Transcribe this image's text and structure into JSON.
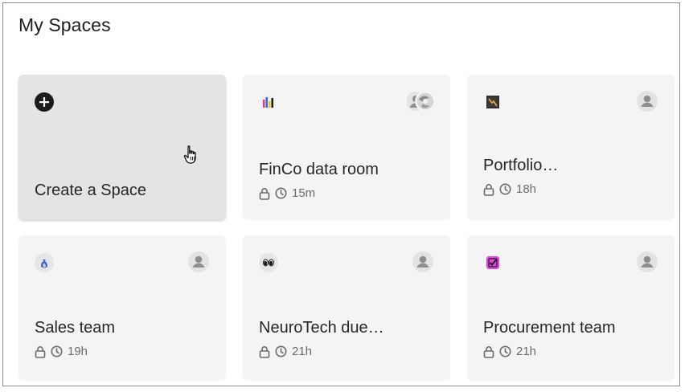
{
  "page": {
    "title": "My Spaces"
  },
  "create_card": {
    "label": "Create a Space",
    "icon": "plus-circle-icon"
  },
  "spaces": [
    {
      "name": "FinCo data room",
      "time": "15m",
      "icon": "bar-chart-emoji-icon",
      "avatar": "shared-avatars-icon"
    },
    {
      "name": "Portfolio…",
      "time": "18h",
      "icon": "chart-down-emoji-icon",
      "avatar": "user-avatar-icon"
    },
    {
      "name": "Sales team",
      "time": "19h",
      "icon": "money-bag-emoji-icon",
      "avatar": "user-avatar-icon"
    },
    {
      "name": "NeuroTech due…",
      "time": "21h",
      "icon": "eyes-emoji-icon",
      "avatar": "user-avatar-icon"
    },
    {
      "name": "Procurement team",
      "time": "21h",
      "icon": "checkbox-emoji-icon",
      "avatar": "user-avatar-icon"
    }
  ],
  "colors": {
    "card_bg": "#f4f4f4",
    "create_card_bg": "#e4e4e4",
    "text": "#1f1f1f",
    "meta_text": "#6b6b6b",
    "procurement_icon": "#e645e6"
  }
}
